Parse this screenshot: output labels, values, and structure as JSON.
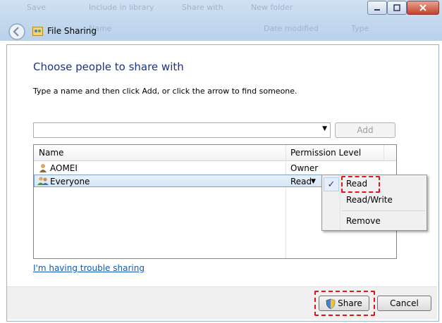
{
  "background": {
    "toolbar_items": [
      "Save",
      "Include in library",
      "Share with",
      "New folder"
    ],
    "columns": [
      "Name",
      "Date modified",
      "Type"
    ]
  },
  "dialog": {
    "title": "File Sharing",
    "heading": "Choose people to share with",
    "instruction": "Type a name and then click Add, or click the arrow to find someone.",
    "name_input": {
      "value": "",
      "placeholder": ""
    },
    "add_button": "Add",
    "table": {
      "columns": [
        "Name",
        "Permission Level"
      ],
      "rows": [
        {
          "name": "AOMEI",
          "permission": "Owner",
          "icon": "user-icon"
        },
        {
          "name": "Everyone",
          "permission": "Read",
          "icon": "group-icon",
          "selected": true
        }
      ]
    },
    "permission_menu": {
      "items": [
        {
          "label": "Read",
          "checked": true
        },
        {
          "label": "Read/Write",
          "checked": false
        },
        {
          "label": "Remove",
          "checked": false
        }
      ],
      "check_mark": "✓"
    },
    "trouble_link": "I'm having trouble sharing",
    "share_button": "Share",
    "cancel_button": "Cancel"
  },
  "colors": {
    "heading": "#1e3287",
    "highlight_dash": "#e0161b",
    "link": "#0f5ab5"
  }
}
